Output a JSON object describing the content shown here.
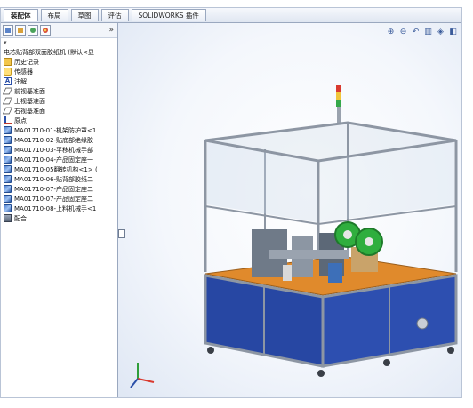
{
  "tabs": [
    {
      "label": "装配体",
      "active": true
    },
    {
      "label": "布局",
      "active": false
    },
    {
      "label": "草图",
      "active": false
    },
    {
      "label": "评估",
      "active": false
    },
    {
      "label": "SOLIDWORKS 插件",
      "active": false
    }
  ],
  "panel": {
    "more": "»",
    "filter": "▾",
    "root": "电芯贴背部双面胶纸机 (默认<显",
    "items": [
      {
        "label": "历史记录",
        "icon": "history-folder-icon"
      },
      {
        "label": "传感器",
        "icon": "sensor-icon"
      },
      {
        "label": "注解",
        "icon": "annotation-icon"
      },
      {
        "label": "前视基准面",
        "icon": "plane-icon"
      },
      {
        "label": "上视基准面",
        "icon": "plane-icon"
      },
      {
        "label": "右视基准面",
        "icon": "plane-icon"
      },
      {
        "label": "原点",
        "icon": "origin-icon"
      },
      {
        "label": "MA01710-01-机架防护罩<1",
        "icon": "part-icon"
      },
      {
        "label": "MA01710-02-贴底部绝缘胶",
        "icon": "part-icon"
      },
      {
        "label": "MA01710-03-平移机械手部",
        "icon": "part-icon"
      },
      {
        "label": "MA01710-04-产品固定座一",
        "icon": "part-icon"
      },
      {
        "label": "MA01710-05翻转机构<1> (",
        "icon": "part-icon"
      },
      {
        "label": "MA01710-06-贴背部胶纸二",
        "icon": "part-icon"
      },
      {
        "label": "MA01710-07-产品固定座二",
        "icon": "part-icon"
      },
      {
        "label": "MA01710-07-产品固定座二",
        "icon": "part-icon"
      },
      {
        "label": "MA01710-08-上料机械手<1",
        "icon": "part-icon"
      },
      {
        "label": "配合",
        "icon": "mate-icon"
      }
    ]
  },
  "colors": {
    "frame": "#e9eef7",
    "machine_blue": "#2747a3",
    "aluminum": "#c7ccd4",
    "orange_plate": "#e08a2c",
    "reel_green": "#2fae3e"
  }
}
